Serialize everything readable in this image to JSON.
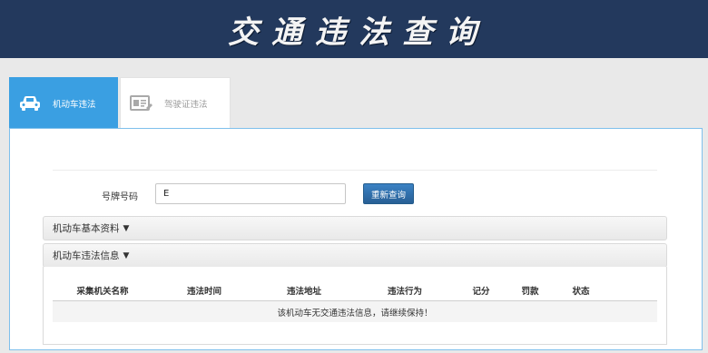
{
  "header": {
    "title": "交通违法查询"
  },
  "tabs": [
    {
      "label": "机动车违法",
      "icon": "car-icon",
      "active": true
    },
    {
      "label": "驾驶证违法",
      "icon": "license-card-icon",
      "active": false
    }
  ],
  "form": {
    "plate_label": "号牌号码",
    "plate_value": "E",
    "requery_label": "重新查询"
  },
  "sections": {
    "basic_info": "机动车基本资料",
    "violation_info": "机动车违法信息"
  },
  "table": {
    "columns": [
      "采集机关名称",
      "违法时间",
      "违法地址",
      "违法行为",
      "记分",
      "罚款",
      "状态"
    ],
    "empty_message": "该机动车无交通违法信息，请继续保持！"
  },
  "colors": {
    "header_bg": "#23395d",
    "tab_active": "#3a9fe2",
    "button": "#2d6ea8"
  }
}
